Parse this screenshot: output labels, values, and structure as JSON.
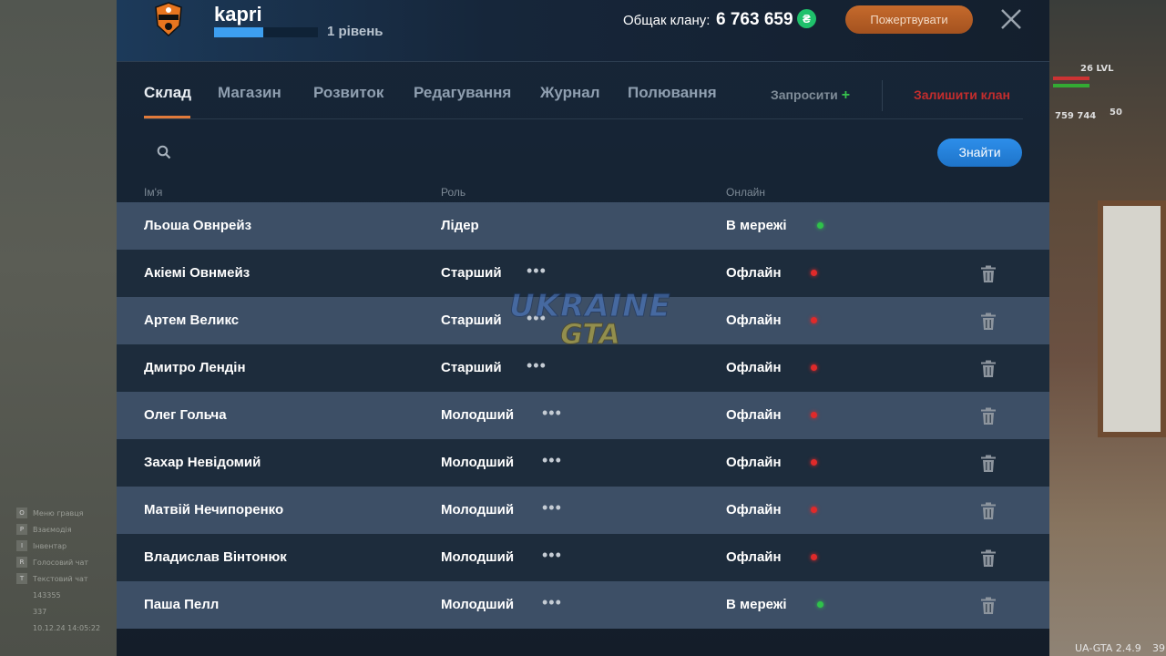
{
  "header": {
    "clan_name": "kapri",
    "level_label": "1 рівень",
    "level_progress": 0.47,
    "treasury_label": "Общак клану:",
    "treasury_value": "6 763 659",
    "coin_symbol": "₴",
    "donate_label": "Пожертвувати"
  },
  "tabs": [
    {
      "label": "Склад",
      "active": true
    },
    {
      "label": "Магазин",
      "active": false
    },
    {
      "label": "Розвиток",
      "active": false
    },
    {
      "label": "Редагування",
      "active": false
    },
    {
      "label": "Журнал",
      "active": false
    },
    {
      "label": "Полювання",
      "active": false
    }
  ],
  "actions": {
    "invite_label": "Запросити",
    "invite_plus": "+",
    "leave_label": "Залишити клан"
  },
  "search": {
    "placeholder": "",
    "value": "",
    "find_label": "Знайти"
  },
  "columns": {
    "name": "Ім'я",
    "role": "Роль",
    "online": "Онлайн"
  },
  "members": [
    {
      "name": "Льоша Овнрейз",
      "role": "Лідер",
      "status": "В мережі",
      "online": true,
      "menu": false,
      "delete": false
    },
    {
      "name": "Акіемі Овнмейз",
      "role": "Старший",
      "status": "Офлайн",
      "online": false,
      "menu": true,
      "delete": true
    },
    {
      "name": "Артем Великс",
      "role": "Старший",
      "status": "Офлайн",
      "online": false,
      "menu": true,
      "delete": true
    },
    {
      "name": "Дмитро Лендін",
      "role": "Старший",
      "status": "Офлайн",
      "online": false,
      "menu": true,
      "delete": true
    },
    {
      "name": "Олег Гольча",
      "role": "Молодший",
      "status": "Офлайн",
      "online": false,
      "menu": true,
      "delete": true
    },
    {
      "name": "Захар Невідомий",
      "role": "Молодший",
      "status": "Офлайн",
      "online": false,
      "menu": true,
      "delete": true
    },
    {
      "name": "Матвій Нечипоренко",
      "role": "Молодший",
      "status": "Офлайн",
      "online": false,
      "menu": true,
      "delete": true
    },
    {
      "name": "Владислав Вінтонюк",
      "role": "Молодший",
      "status": "Офлайн",
      "online": false,
      "menu": true,
      "delete": true
    },
    {
      "name": "Паша Пелл",
      "role": "Молодший",
      "status": "В мережі",
      "online": true,
      "menu": true,
      "delete": true
    }
  ],
  "colors": {
    "online": "#2fc24a",
    "offline": "#e02a2a",
    "accent_orange": "#e07a3b",
    "accent_blue": "#2d8eea",
    "leave_red": "#c22d2d"
  },
  "watermark": {
    "line1": "UKRAINE",
    "line2": "GTA"
  },
  "hud": {
    "level": "26 LVL",
    "money": "759 744",
    "ammo": "50",
    "version": "UA-GTA 2.4.9",
    "version_suffix": "39",
    "left_items": [
      {
        "key": "O",
        "label": "Меню гравця"
      },
      {
        "key": "P",
        "label": "Взаємодія"
      },
      {
        "key": "I",
        "label": "Інвентар"
      },
      {
        "key": "R",
        "label": "Голосовий чат"
      },
      {
        "key": "T",
        "label": "Текстовий чат"
      }
    ],
    "id_value": "143355",
    "online_value": "337",
    "datetime": "10.12.24 14:05:22"
  }
}
